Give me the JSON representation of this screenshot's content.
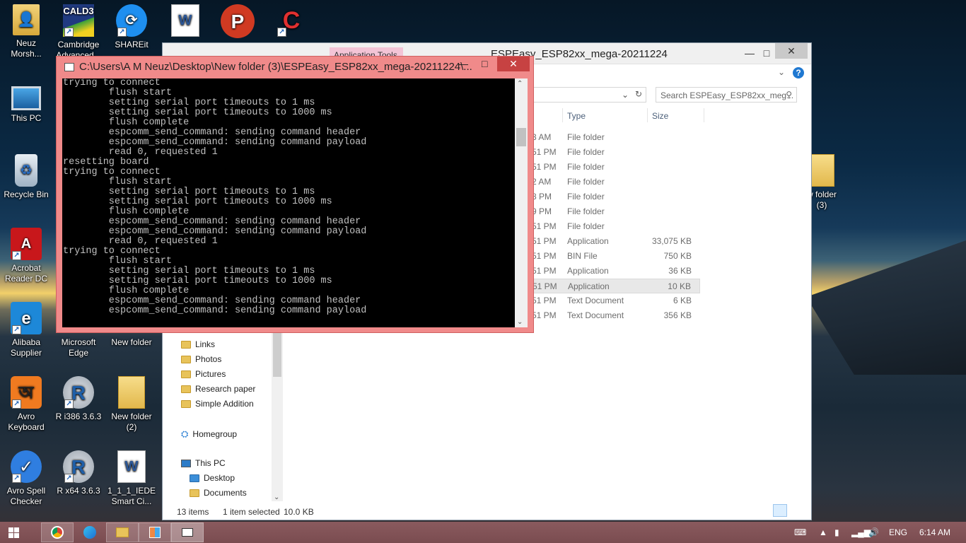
{
  "desktop": {
    "icons": [
      {
        "label": "Neuz\nMorsh...",
        "glyph": "👤",
        "shortcut": false
      },
      {
        "label": "Cambridge\nAdvanced...",
        "glyph": "CALD3",
        "shortcut": true
      },
      {
        "label": "SHAREit",
        "glyph": "⟳",
        "shortcut": true
      },
      {
        "label": "",
        "glyph": "W",
        "shortcut": false
      },
      {
        "label": "",
        "glyph": "P",
        "shortcut": false
      },
      {
        "label": "",
        "glyph": "C",
        "shortcut": true
      },
      {
        "label": "This PC",
        "glyph": "🖥",
        "shortcut": false
      },
      {
        "label": "Recycle Bin",
        "glyph": "🗑",
        "shortcut": false
      },
      {
        "label": "Acrobat\nReader DC",
        "glyph": "A",
        "shortcut": true
      },
      {
        "label": "Alibaba\nSupplier",
        "glyph": "e",
        "shortcut": true
      },
      {
        "label": "Microsoft\nEdge",
        "glyph": "e",
        "shortcut": false
      },
      {
        "label": "New folder",
        "glyph": "",
        "shortcut": false
      },
      {
        "label": "Avro\nKeyboard",
        "glyph": "অ",
        "shortcut": true
      },
      {
        "label": "R i386 3.6.3",
        "glyph": "R",
        "shortcut": true
      },
      {
        "label": "New folder\n(2)",
        "glyph": "",
        "shortcut": false
      },
      {
        "label": "Avro Spell\nChecker",
        "glyph": "✓",
        "shortcut": true
      },
      {
        "label": "R x64 3.6.3",
        "glyph": "R",
        "shortcut": true
      },
      {
        "label": "1_1_1_IEDE\nSmart Ci...",
        "glyph": "W",
        "shortcut": false
      },
      {
        "label": "w folder\n(3)",
        "glyph": "",
        "shortcut": false
      }
    ]
  },
  "explorer": {
    "title": "ESPEasy_ESP82xx_mega-20211224",
    "context_tab": "Application Tools",
    "search_placeholder": "Search ESPEasy_ESP82xx_meg...",
    "columns": {
      "type": "Type",
      "size": "Size"
    },
    "rows": [
      {
        "date": "3 AM",
        "type": "File folder",
        "size": ""
      },
      {
        "date": "51 PM",
        "type": "File folder",
        "size": ""
      },
      {
        "date": "51 PM",
        "type": "File folder",
        "size": ""
      },
      {
        "date": "2 AM",
        "type": "File folder",
        "size": ""
      },
      {
        "date": "8 PM",
        "type": "File folder",
        "size": ""
      },
      {
        "date": "9 PM",
        "type": "File folder",
        "size": ""
      },
      {
        "date": "51 PM",
        "type": "File folder",
        "size": ""
      },
      {
        "date": "51 PM",
        "type": "Application",
        "size": "33,075 KB"
      },
      {
        "date": "51 PM",
        "type": "BIN File",
        "size": "750 KB"
      },
      {
        "date": "51 PM",
        "type": "Application",
        "size": "36 KB"
      },
      {
        "date": "51 PM",
        "type": "Application",
        "size": "10 KB"
      },
      {
        "date": "51 PM",
        "type": "Text Document",
        "size": "6 KB"
      },
      {
        "date": "51 PM",
        "type": "Text Document",
        "size": "356 KB"
      }
    ],
    "nav": {
      "links": "Links",
      "photos": "Photos",
      "pictures": "Pictures",
      "research": "Research paper",
      "simple": "Simple Addition",
      "homegroup": "Homegroup",
      "thispc": "This PC",
      "desktop": "Desktop",
      "documents": "Documents"
    },
    "status": {
      "items": "13 items",
      "selected": "1 item selected",
      "size": "10.0 KB"
    }
  },
  "console": {
    "title": "C:\\Users\\A M Neuz\\Desktop\\New folder (3)\\ESPEasy_ESP82xx_mega-20211224\\...",
    "lines": "trying to connect\n        flush start\n        setting serial port timeouts to 1 ms\n        setting serial port timeouts to 1000 ms\n        flush complete\n        espcomm_send_command: sending command header\n        espcomm_send_command: sending command payload\n        read 0, requested 1\nresetting board\ntrying to connect\n        flush start\n        setting serial port timeouts to 1 ms\n        setting serial port timeouts to 1000 ms\n        flush complete\n        espcomm_send_command: sending command header\n        espcomm_send_command: sending command payload\n        read 0, requested 1\ntrying to connect\n        flush start\n        setting serial port timeouts to 1 ms\n        setting serial port timeouts to 1000 ms\n        flush complete\n        espcomm_send_command: sending command header\n        espcomm_send_command: sending command payload"
  },
  "taskbar": {
    "lang": "ENG",
    "time": "6:14 AM"
  }
}
